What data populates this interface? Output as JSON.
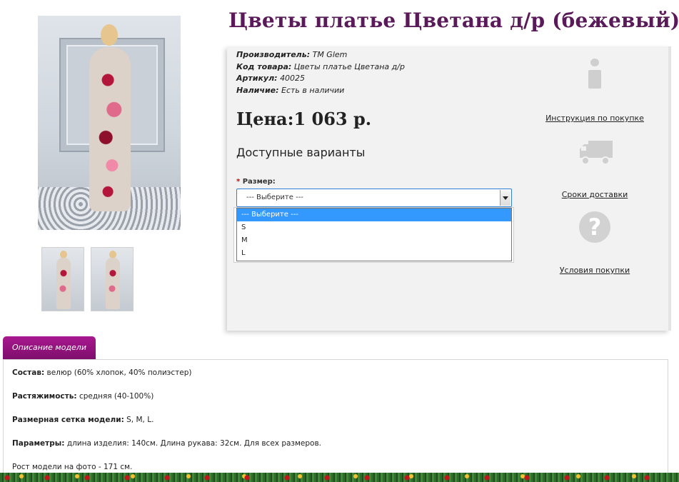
{
  "product": {
    "title": "Цветы платье Цветана д/р (бежевый)"
  },
  "meta": {
    "manufacturer_label": "Производитель:",
    "manufacturer_value": "ТМ Glem",
    "code_label": "Код товара:",
    "code_value": "Цветы платье Цветана д/р",
    "article_label": "Артикул:",
    "article_value": "40025",
    "stock_label": "Наличие:",
    "stock_value": "Есть в наличии"
  },
  "price": "Цена:1 063 р.",
  "variants_heading": "Доступные варианты",
  "size": {
    "required_mark": "*",
    "label": "Размер:",
    "selected": "--- Выберите ---",
    "options": [
      "--- Выберите ---",
      "S",
      "M",
      "L"
    ]
  },
  "side": {
    "instruction_link": "Инструкция по покупке",
    "delivery_link": "Сроки доставки",
    "terms_link": "Условия покупки",
    "instruction_icon": "info-icon",
    "delivery_icon": "truck-icon",
    "terms_icon": "question-icon",
    "help_glyph": "?"
  },
  "description": {
    "tab_label": "Описание модели",
    "composition_label": "Состав:",
    "composition_value": "велюр (60% хлопок, 40% полиэстер)",
    "stretch_label": "Растяжимость:",
    "stretch_value": "средняя (40-100%)",
    "sizes_label": "Размерная сетка модели:",
    "sizes_value": "S, M, L.",
    "params_label": "Параметры:",
    "params_value": "длина изделия: 140см. Длина рукава: 32см. Для всех размеров.",
    "model_height": "Рост модели на фото - 171 см."
  },
  "colors": {
    "title": "#5a1a5a",
    "tab": "#8f1479",
    "select_border": "#2f7fd6",
    "option_highlight": "#3399ff"
  }
}
